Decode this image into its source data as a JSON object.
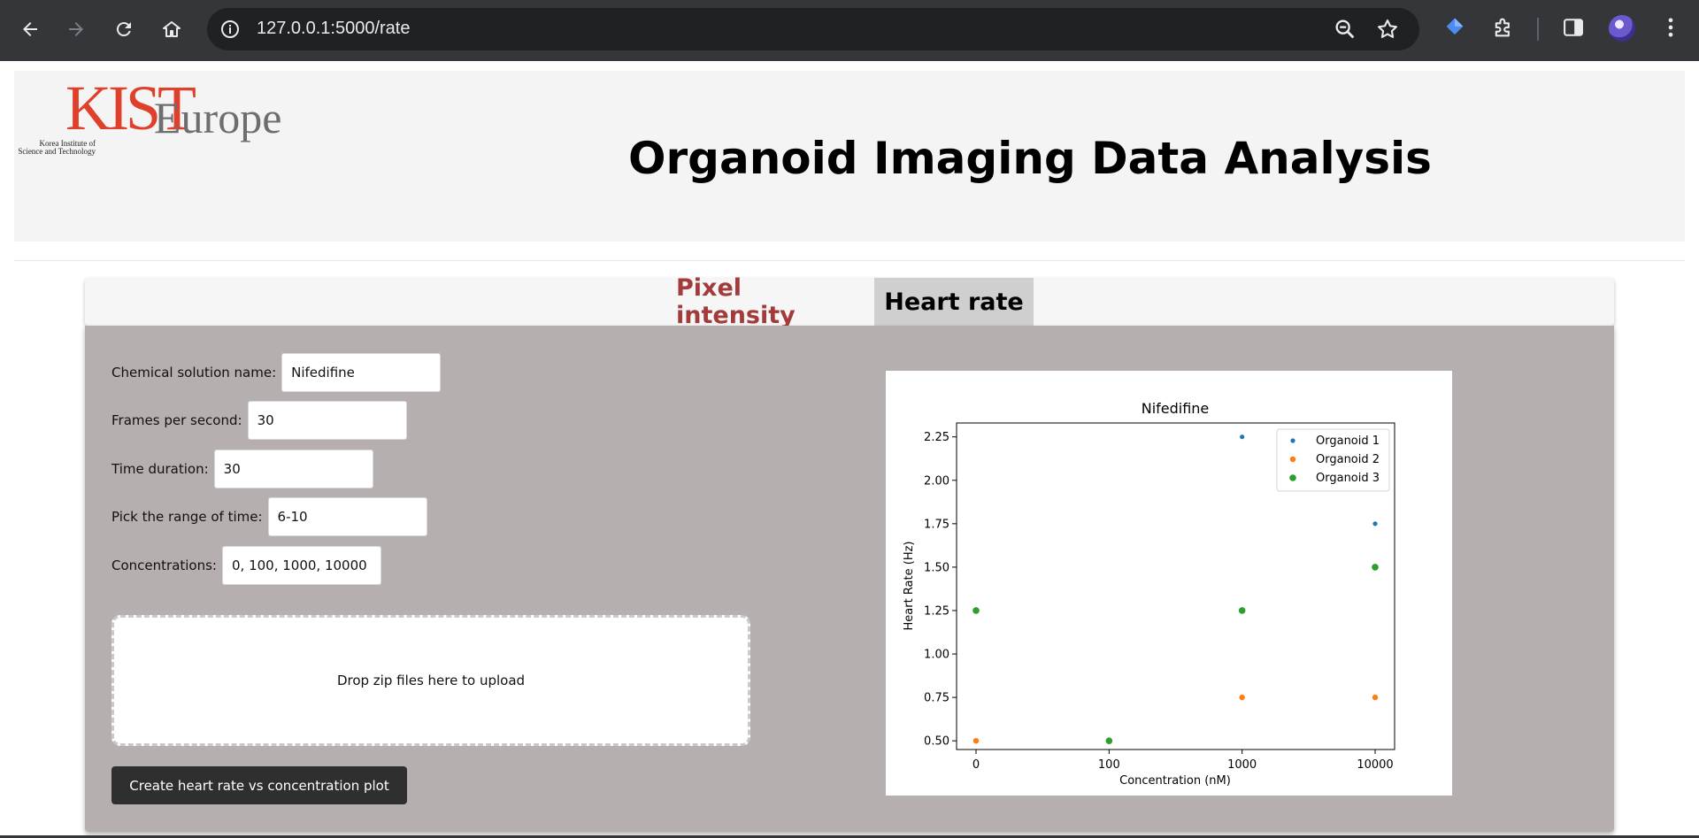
{
  "browser": {
    "url": "127.0.0.1:5000/rate",
    "icons": [
      "back-arrow-icon",
      "forward-arrow-icon",
      "reload-icon",
      "home-icon",
      "site-info-icon",
      "zoom-icon",
      "bookmark-star-icon",
      "extension-diamond-icon",
      "extensions-puzzle-icon",
      "side-panel-icon",
      "profile-avatar",
      "menu-dots-icon"
    ]
  },
  "header": {
    "logo": {
      "mark": "KIST",
      "name": "Europe",
      "tagline_line1": "Korea Institute of",
      "tagline_line2": "Science and Technology"
    },
    "title": "Organoid Imaging Data Analysis"
  },
  "tabs": {
    "pixel": "Pixel intensity",
    "heart": "Heart rate",
    "active": "Heart rate"
  },
  "form": {
    "chemical": {
      "label": "Chemical solution name:",
      "value": "Nifedifine"
    },
    "fps": {
      "label": "Frames per second:",
      "value": "30"
    },
    "duration": {
      "label": "Time duration:",
      "value": "30"
    },
    "range": {
      "label": "Pick the range of time:",
      "value": "6-10"
    },
    "concentrations": {
      "label": "Concentrations:",
      "value": "0, 100, 1000, 10000"
    }
  },
  "dropzone": {
    "text": "Drop zip files here to upload"
  },
  "create_button": "Create heart rate vs concentration plot",
  "colors": {
    "panel": "#b6afaf",
    "active_tab": "#cfcfcf",
    "inactive_tab_text": "#a33b3b",
    "button": "#2f2f2f",
    "logo_red": "#e0402b"
  },
  "chart_data": {
    "type": "scatter",
    "title": "Nifedifine",
    "xlabel": "Concentration (nM)",
    "ylabel": "Heart Rate (Hz)",
    "x_categories": [
      "0",
      "100",
      "1000",
      "10000"
    ],
    "yticks": [
      "0.50",
      "0.75",
      "1.00",
      "1.25",
      "1.50",
      "1.75",
      "2.00",
      "2.25"
    ],
    "ylim": [
      0.45,
      2.33
    ],
    "legend_position": "top-right",
    "series": [
      {
        "name": "Organoid 1",
        "color": "#1f77b4",
        "points": [
          [
            1000,
            2.25
          ],
          [
            10000,
            1.75
          ]
        ]
      },
      {
        "name": "Organoid 2",
        "color": "#ff7f0e",
        "points": [
          [
            0,
            0.5
          ],
          [
            1000,
            0.75
          ],
          [
            10000,
            0.75
          ]
        ]
      },
      {
        "name": "Organoid 3",
        "color": "#2ca02c",
        "points": [
          [
            0,
            1.25
          ],
          [
            100,
            0.5
          ],
          [
            1000,
            1.25
          ],
          [
            10000,
            1.5
          ]
        ]
      }
    ]
  }
}
